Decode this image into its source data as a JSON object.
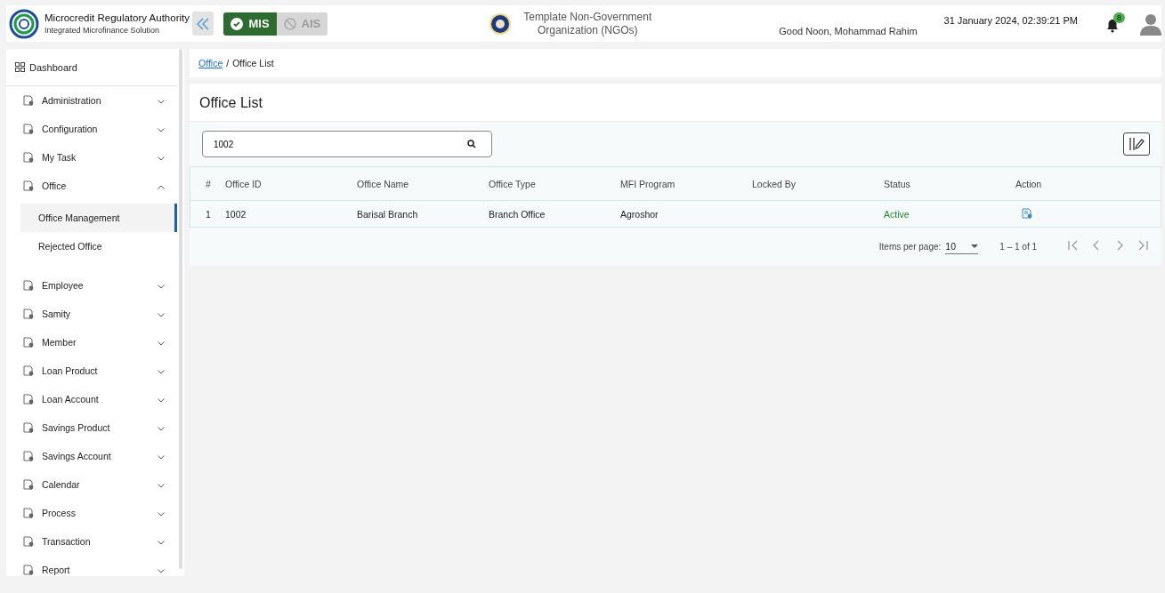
{
  "header": {
    "org_title": "Microcredit Regulatory Authority",
    "org_subtitle": "Integrated Microfinance Solution",
    "modes": [
      {
        "label": "MIS",
        "selected": true
      },
      {
        "label": "AIS",
        "selected": false
      }
    ],
    "ngo": "Template Non-Government Organization (NGOs)",
    "greeting": "Good Noon, Mohammad Rahim",
    "datetime": "31 January 2024, 02:39:21 PM",
    "notification_count": "8"
  },
  "sidebar": {
    "dashboard": "Dashboard",
    "items": [
      {
        "label": "Administration",
        "expanded": false
      },
      {
        "label": "Configuration",
        "expanded": false
      },
      {
        "label": "My Task",
        "expanded": false
      },
      {
        "label": "Office",
        "expanded": true,
        "children": [
          {
            "label": "Office Management",
            "selected": true
          },
          {
            "label": "Rejected Office",
            "selected": false
          }
        ]
      },
      {
        "label": "Employee",
        "expanded": false
      },
      {
        "label": "Samity",
        "expanded": false
      },
      {
        "label": "Member",
        "expanded": false
      },
      {
        "label": "Loan Product",
        "expanded": false
      },
      {
        "label": "Loan Account",
        "expanded": false
      },
      {
        "label": "Savings Product",
        "expanded": false
      },
      {
        "label": "Savings Account",
        "expanded": false
      },
      {
        "label": "Calendar",
        "expanded": false
      },
      {
        "label": "Process",
        "expanded": false
      },
      {
        "label": "Transaction",
        "expanded": false
      },
      {
        "label": "Report",
        "expanded": false
      }
    ]
  },
  "breadcrumb": [
    {
      "label": "Office",
      "kind": "link"
    },
    {
      "label": "/",
      "kind": "separator"
    },
    {
      "label": "Office List",
      "kind": "current"
    }
  ],
  "page_title": "Office List",
  "search": {
    "value": "1002"
  },
  "table": {
    "columns": [
      "#",
      "Office ID",
      "Office Name",
      "Office Type",
      "MFI Program",
      "Locked By",
      "Status",
      "Action"
    ],
    "rows": [
      {
        "cells": [
          "1",
          "1002",
          "Barisal Branch",
          "Branch Office",
          "Agroshor",
          ""
        ],
        "status": "Active"
      }
    ]
  },
  "paginator": {
    "label": "Items per page:",
    "page_size": "10",
    "range": "1 – 1 of 1"
  }
}
